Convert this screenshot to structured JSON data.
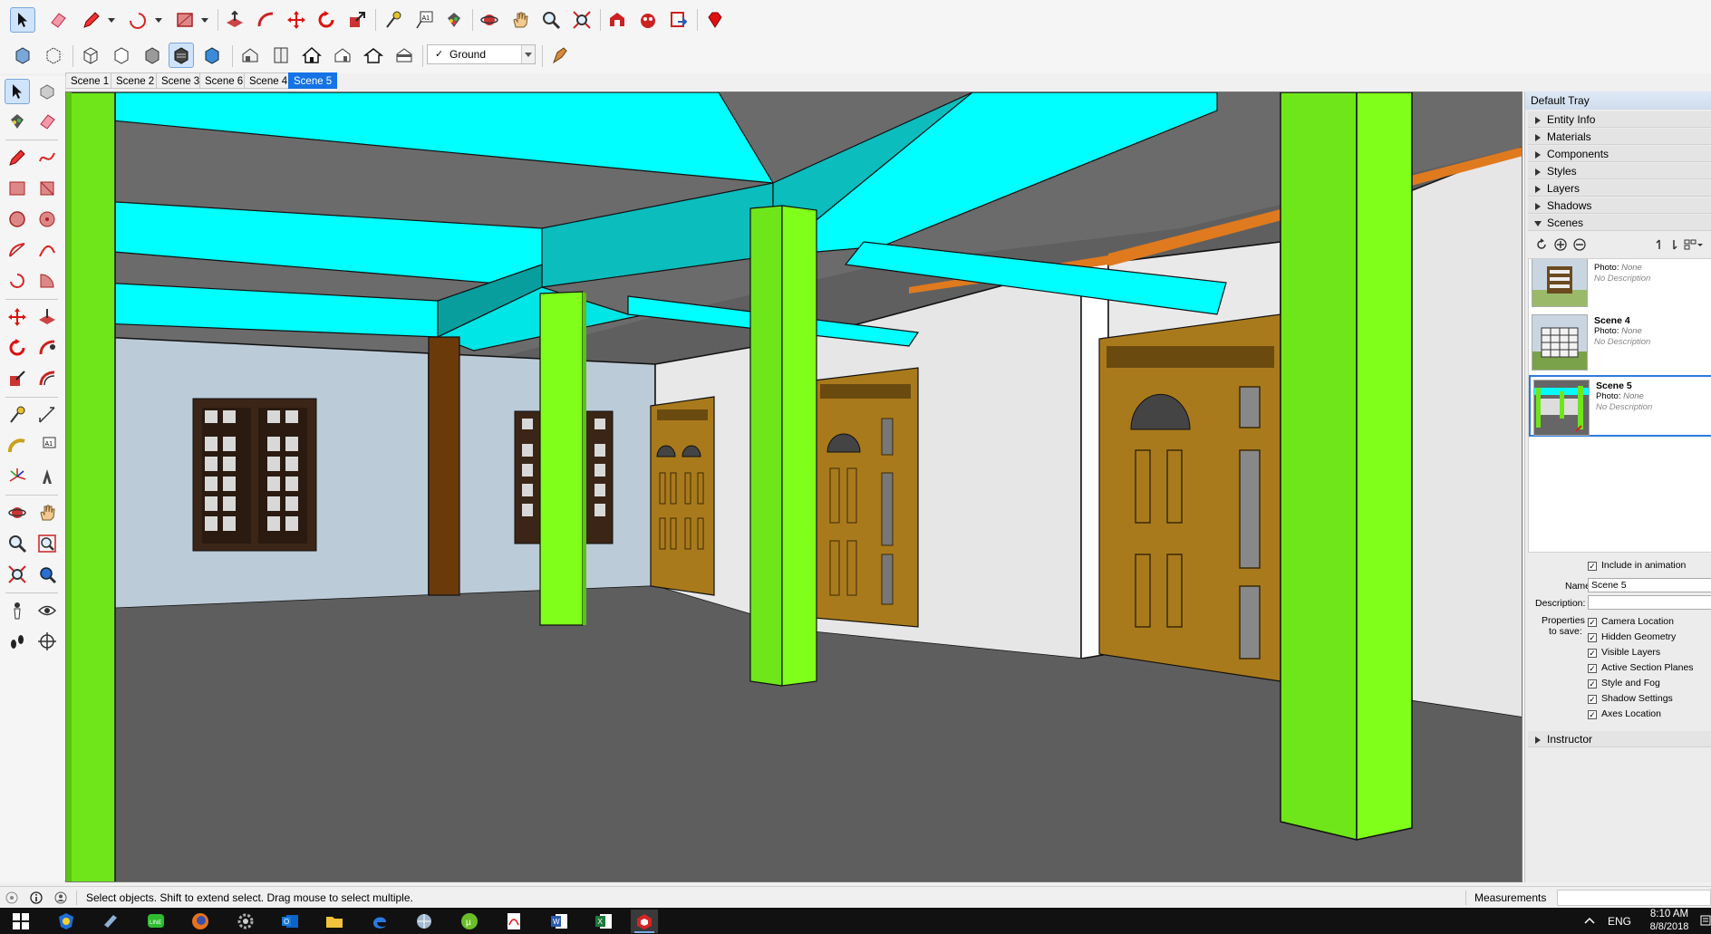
{
  "scene_tabs": [
    "Scene 1",
    "Scene 2",
    "Scene 3",
    "Scene 6",
    "Scene 4",
    "Scene 5"
  ],
  "active_scene_tab": "Scene 5",
  "layer_dropdown": {
    "check": "✓",
    "value": "Ground"
  },
  "tray": {
    "title": "Default Tray",
    "sections": [
      "Entity Info",
      "Materials",
      "Components",
      "Styles",
      "Layers",
      "Shadows",
      "Scenes"
    ],
    "open_section": "Scenes",
    "instructor": "Instructor"
  },
  "scene_list": [
    {
      "name": "",
      "photo_label": "Photo:",
      "photo_value": "None",
      "description": "No Description"
    },
    {
      "name": "Scene 4",
      "photo_label": "Photo:",
      "photo_value": "None",
      "description": "No Description"
    },
    {
      "name": "Scene 5",
      "photo_label": "Photo:",
      "photo_value": "None",
      "description": "No Description"
    }
  ],
  "scene_props": {
    "include_animation": "Include in animation",
    "name_label": "Name:",
    "name_value": "Scene 5",
    "description_label": "Description:",
    "properties_label_1": "Properties",
    "properties_label_2": "to save:",
    "properties": [
      "Camera Location",
      "Hidden Geometry",
      "Visible Layers",
      "Active Section Planes",
      "Style and Fog",
      "Shadow Settings",
      "Axes Location"
    ]
  },
  "status": {
    "message": "Select objects. Shift to extend select. Drag mouse to select multiple.",
    "measurements_label": "Measurements"
  },
  "taskbar": {
    "lang": "ENG",
    "time": "8:10 AM",
    "date": "8/8/2018"
  },
  "colors": {
    "column_green": "#6fe61a",
    "beam_cyan": "#00ffff",
    "floor": "#5e5e5e",
    "ceiling": "#6b6b6b",
    "wood": "#a97a1c",
    "active_blue": "#1473e6"
  }
}
